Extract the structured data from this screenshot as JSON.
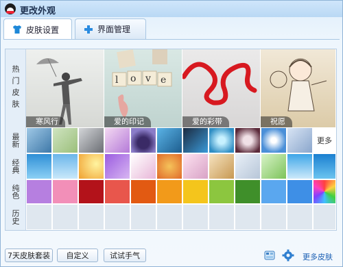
{
  "window": {
    "title": "更改外观"
  },
  "tabs": [
    {
      "label": "皮肤设置",
      "icon": "shirt-icon",
      "active": true
    },
    {
      "label": "界面管理",
      "icon": "plus-icon",
      "active": false
    }
  ],
  "rows": {
    "hot": "热门皮肤",
    "latest": "最新",
    "classic": "经典",
    "solid": "纯色",
    "history": "历史"
  },
  "hot_skins": [
    {
      "label": "寒风行"
    },
    {
      "label": "爱的印记"
    },
    {
      "label": "爱的彩带"
    },
    {
      "label": "祝愿"
    }
  ],
  "latest_more": "更多",
  "solid_colors": [
    "#b67fe0",
    "#f28fb8",
    "#b3121a",
    "#e8564c",
    "#e25a12",
    "#f29a1a",
    "#f4c51c",
    "#8cc63f",
    "#3f8f2a",
    "#5aa7ef",
    "#3e8fe6"
  ],
  "buttons": {
    "seven_day": "7天皮肤套装",
    "custom": "自定义",
    "try_luck": "试试手气"
  },
  "footer": {
    "more_skins": "更多皮肤"
  },
  "accent": "#1a5fb4"
}
